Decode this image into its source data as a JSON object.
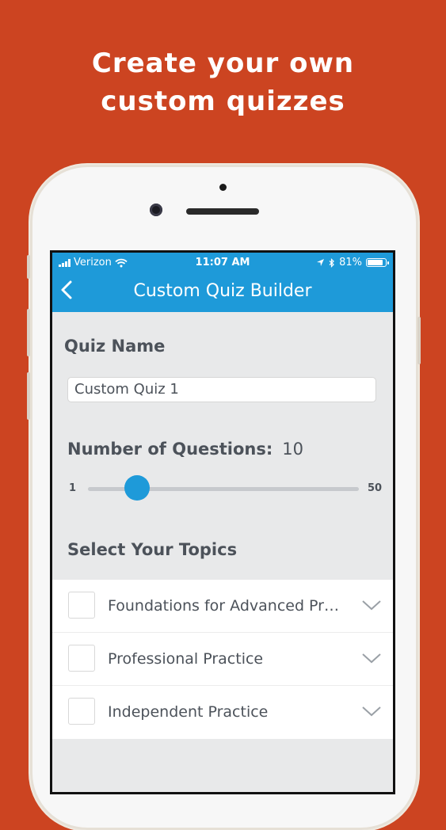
{
  "headline": {
    "line1": "Create your own",
    "line2": "custom quizzes"
  },
  "status_bar": {
    "carrier": "Verizon",
    "time": "11:07 AM",
    "battery": "81%"
  },
  "app_bar": {
    "title": "Custom Quiz Builder"
  },
  "quiz_name": {
    "label": "Quiz Name",
    "value": "Custom Quiz 1"
  },
  "questions": {
    "label": "Number of Questions:",
    "value": "10",
    "min": "1",
    "max": "50",
    "fraction": 0.18
  },
  "topics": {
    "label": "Select Your Topics",
    "items": [
      {
        "label": "Foundations for Advanced Practice"
      },
      {
        "label": "Professional Practice"
      },
      {
        "label": "Independent Practice"
      }
    ]
  },
  "colors": {
    "background": "#cc4421",
    "accent": "#1e9ad9"
  }
}
